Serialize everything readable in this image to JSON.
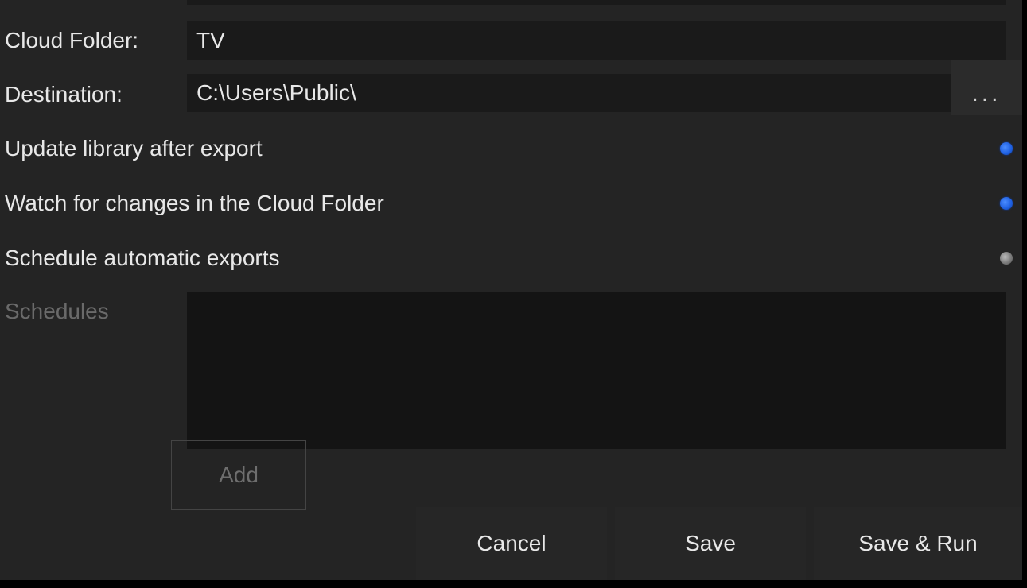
{
  "fields": {
    "cloud_folder_label": "Cloud Folder:",
    "cloud_folder_value": "TV",
    "destination_label": "Destination:",
    "destination_value": "C:\\Users\\Public\\",
    "browse_label": "..."
  },
  "toggles": {
    "update_library_label": "Update library after export",
    "update_library_on": true,
    "watch_changes_label": "Watch for changes in the Cloud Folder",
    "watch_changes_on": true,
    "schedule_exports_label": "Schedule automatic exports",
    "schedule_exports_on": false
  },
  "schedules": {
    "label": "Schedules",
    "add_button_label": "Add"
  },
  "footer": {
    "cancel_label": "Cancel",
    "save_label": "Save",
    "save_run_label": "Save & Run"
  }
}
